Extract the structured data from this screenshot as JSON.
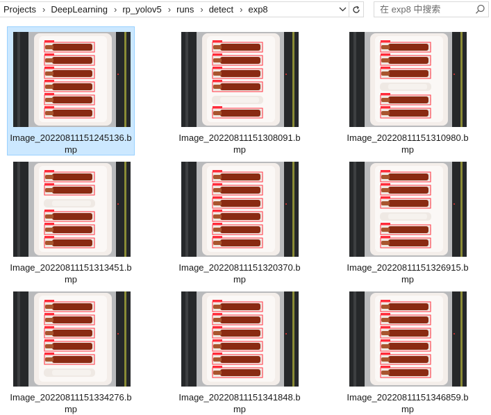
{
  "address_bar": {
    "crumbs": [
      "Projects",
      "DeepLearning",
      "rp_yolov5",
      "runs",
      "detect",
      "exp8"
    ],
    "separator": "›",
    "dropdown_icon": "chevron-down-icon",
    "refresh_icon": "refresh-icon"
  },
  "search": {
    "placeholder": "在 exp8 中搜索",
    "icon": "search-icon"
  },
  "files": [
    {
      "line1": "Image_20220811151245136.b",
      "line2": "mp",
      "selected": true
    },
    {
      "line1": "Image_20220811151308091.b",
      "line2": "mp",
      "selected": false
    },
    {
      "line1": "Image_20220811151310980.b",
      "line2": "mp",
      "selected": false
    },
    {
      "line1": "Image_20220811151313451.b",
      "line2": "mp",
      "selected": false
    },
    {
      "line1": "Image_20220811151320370.b",
      "line2": "mp",
      "selected": false
    },
    {
      "line1": "Image_20220811151326915.b",
      "line2": "mp",
      "selected": false
    },
    {
      "line1": "Image_20220811151334276.b",
      "line2": "mp",
      "selected": false
    },
    {
      "line1": "Image_20220811151341848.b",
      "line2": "mp",
      "selected": false
    },
    {
      "line1": "Image_20220811151346859.b",
      "line2": "mp",
      "selected": false
    }
  ],
  "colors": {
    "selection_bg": "#cce8ff",
    "selection_border": "#99d1ff",
    "detection_box": "#ff2b3a",
    "ampoule_liquid": "#8a2a12",
    "tray": "#f4eeea"
  }
}
